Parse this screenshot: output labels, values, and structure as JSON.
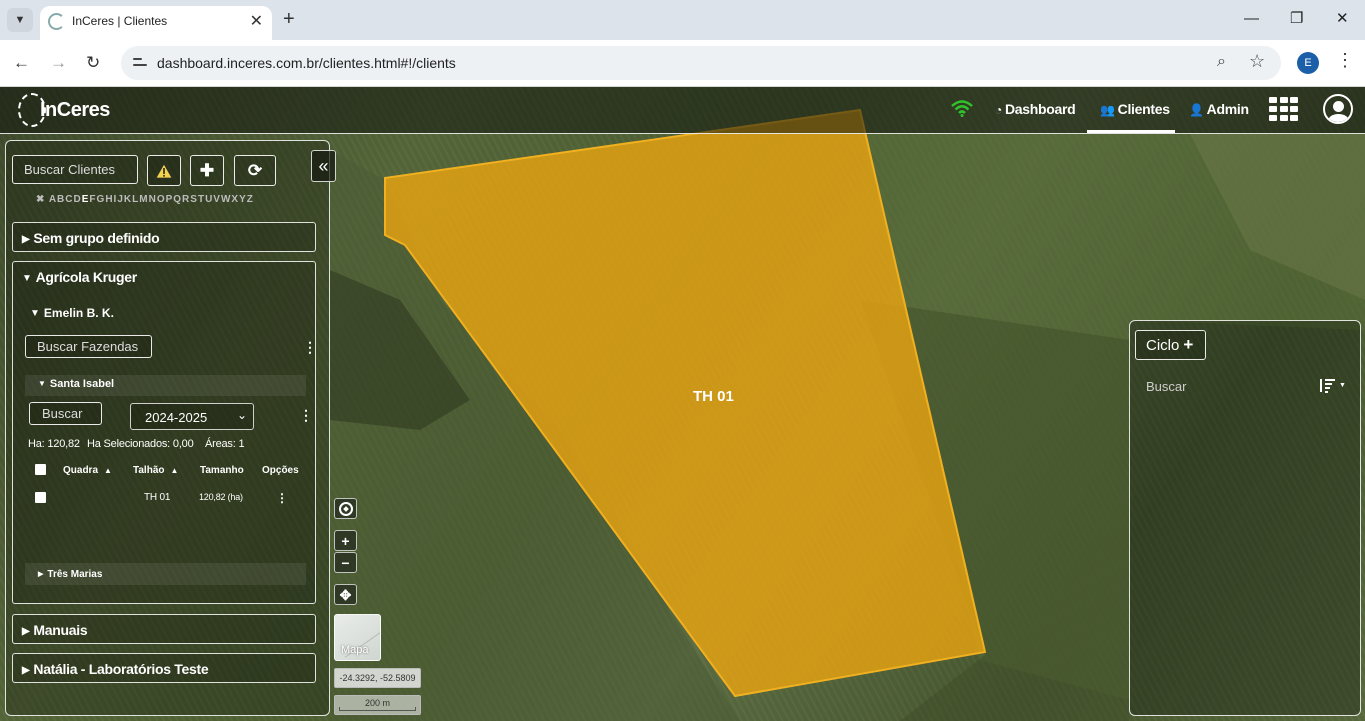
{
  "browser": {
    "tab_title": "InCeres | Clientes",
    "url": "dashboard.inceres.com.br/clientes.html#!/clients",
    "profile_initial": "E"
  },
  "header": {
    "logo": "InCeres",
    "nav": [
      {
        "label": "Dashboard",
        "icon": "dashboard-icon"
      },
      {
        "label": "Clientes",
        "icon": "users-icon"
      },
      {
        "label": "Admin",
        "icon": "user-plus-icon"
      }
    ],
    "active_nav": "Clientes",
    "colors": {
      "wifi": "#31c22b",
      "accent": "#ffffff"
    }
  },
  "left_panel": {
    "search_placeholder": "Buscar Clientes",
    "alphabet_clear": "✖",
    "alphabet": [
      "A",
      "B",
      "C",
      "D",
      "E",
      "F",
      "G",
      "H",
      "I",
      "J",
      "K",
      "L",
      "M",
      "N",
      "O",
      "P",
      "Q",
      "R",
      "S",
      "T",
      "U",
      "V",
      "W",
      "X",
      "Y",
      "Z"
    ],
    "active_letter": "E",
    "groups": {
      "sem_grupo": "Sem grupo definido",
      "agricola": "Agrícola Kruger",
      "manuais": "Manuais",
      "natalia": "Natália - Laboratórios Teste"
    },
    "client": {
      "name": "Emelin B. K.",
      "search_farms_placeholder": "Buscar Fazendas",
      "farm": {
        "name": "Santa Isabel",
        "search_placeholder": "Buscar",
        "season": "2024-2025",
        "stats": {
          "ha": "Ha: 120,82",
          "selected": "Ha Selecionados: 0,00",
          "areas": "Áreas: 1"
        },
        "table": {
          "headers": [
            "Quadra",
            "Talhão",
            "Tamanho",
            "Opções"
          ],
          "rows": [
            {
              "quadra": "",
              "talhao": "TH 01",
              "tamanho": "120,82 (ha)"
            }
          ]
        }
      },
      "other_farm": "Três Marias"
    }
  },
  "map": {
    "polygon_label": "TH 01",
    "polygon_color": "#e8a411",
    "basemap_label": "Mapa",
    "coords": "-24.3292, -52.5809",
    "scale": "200 m"
  },
  "right_panel": {
    "ciclo_label": "Ciclo",
    "search_placeholder": "Buscar"
  }
}
